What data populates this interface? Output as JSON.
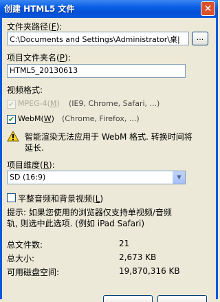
{
  "window": {
    "title": "创建 HTML5 文件",
    "close_glyph": "✕"
  },
  "folder_path": {
    "label": "文件夹路径",
    "accel": "F",
    "value": "C:\\Documents and Settings\\Administrator\\桌|",
    "browse_label": "..."
  },
  "project_name": {
    "label": "项目文件夹名",
    "accel": "P",
    "value": "HTML5_20130613"
  },
  "video_format": {
    "label": "视频格式:",
    "options": [
      {
        "label": "MPEG-4",
        "accel": "M",
        "note": "(IE9, Chrome, Safari, ...)",
        "checked": true,
        "disabled": true
      },
      {
        "label": "WebM",
        "accel": "W",
        "note": "(Chrome, Firefox, ...)",
        "checked": true,
        "disabled": false
      }
    ]
  },
  "warning": {
    "icon": "warning-icon",
    "line1": "智能渲染无法应用于 WebM 格式. 转换时间将",
    "line2": "延长."
  },
  "dimension": {
    "label": "项目维度",
    "accel": "R",
    "selected": "SD (16:9)"
  },
  "flat_audio": {
    "label": "平整音频和背景视频",
    "accel": "L",
    "checked": false
  },
  "hint": {
    "line1": "提示: 如果您使用的浏览器仅支持单视频/音频",
    "line2": "轨, 则选中此选项. (例如 iPad Safari)"
  },
  "stats": {
    "total_files_label": "总文件数:",
    "total_files_value": "21",
    "total_size_label": "总大小:",
    "total_size_value": "2,673 KB",
    "free_space_label": "可用磁盘空间:",
    "free_space_value": "19,870,316 KB"
  }
}
